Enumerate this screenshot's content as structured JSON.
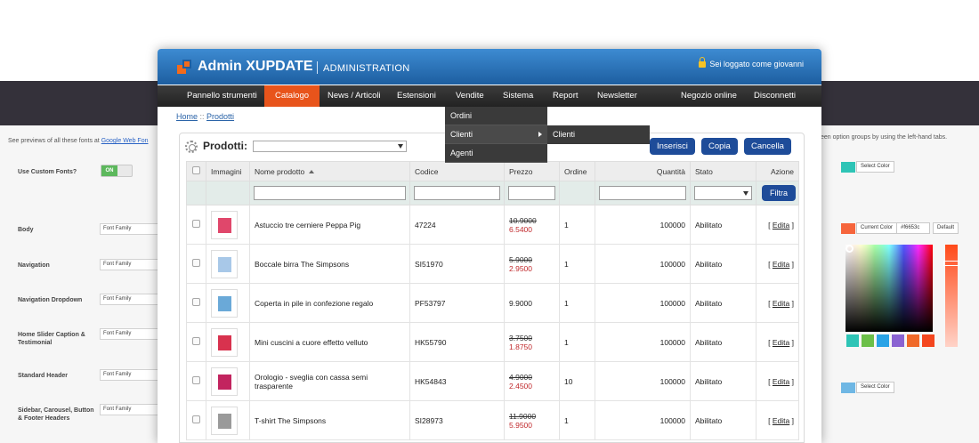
{
  "background_panel": {
    "intro_text": "See previews of all these fonts at",
    "intro_link": "Google Web Fon",
    "right_intro": "een option groups by using the left-hand tabs.",
    "use_custom_fonts_label": "Use Custom Fonts?",
    "toggle_on_label": "ON",
    "font_rows": [
      {
        "label": "Body",
        "select": "Font Family"
      },
      {
        "label": "Navigation",
        "select": "Font Family"
      },
      {
        "label": "Navigation Dropdown",
        "select": "Font Family"
      },
      {
        "label": "Home Slider Caption & Testimonial",
        "select": "Font Family"
      },
      {
        "label": "Standard Header",
        "select": "Font Family"
      },
      {
        "label": "Sidebar, Carousel, Button & Footer Headers",
        "select": "Font Family"
      }
    ],
    "select_color_label": "Select Color",
    "current_color_label": "Current Color",
    "current_color_value": "#f6653c",
    "default_label": "Default",
    "colors": {
      "teal": "#2ec4b6",
      "orange": "#f6653c",
      "light_blue": "#6fb7e4"
    },
    "swatches": [
      "#2ec4b6",
      "#4fc3c5",
      "#6cbf49",
      "#2aa3e6",
      "#8a63d2",
      "#f06a2a",
      "#f4471f"
    ]
  },
  "app": {
    "title": "Admin XUPDATE",
    "subtitle": "ADMINISTRATION",
    "login_text": "Sei loggato come giovanni"
  },
  "menu": {
    "items": [
      "Pannello strumenti",
      "Catalogo",
      "News / Articoli",
      "Estensioni",
      "Vendite",
      "Sistema",
      "Report",
      "Newsletter"
    ],
    "active": "Catalogo",
    "right_items": [
      "Negozio online",
      "Disconnetti"
    ],
    "dropdown": [
      "Ordini",
      "Clienti",
      "Agenti"
    ],
    "submenu": [
      "Clienti"
    ]
  },
  "breadcrumb": {
    "home": "Home",
    "sep": " :: ",
    "current": "Prodotti"
  },
  "panel": {
    "title": "Prodotti:",
    "buttons": {
      "insert": "Inserisci",
      "copy": "Copia",
      "delete": "Cancella"
    },
    "filter_button": "Filtra"
  },
  "table": {
    "headers": [
      "Immagini",
      "Nome prodotto",
      "Codice",
      "Prezzo",
      "Ordine",
      "Quantità",
      "Stato",
      "Azione"
    ],
    "rows": [
      {
        "name": "Astuccio tre cerniere Peppa Pig",
        "code": "47224",
        "price_old": "10.9000",
        "price_new": "6.5400",
        "order": "1",
        "qty": "100000",
        "status": "Abilitato",
        "action": "Edita",
        "thumb_color": "#e0476b"
      },
      {
        "name": "Boccale birra The Simpsons",
        "code": "SI51970",
        "price_old": "5.9000",
        "price_new": "2.9500",
        "order": "1",
        "qty": "100000",
        "status": "Abilitato",
        "action": "Edita",
        "thumb_color": "#a8c8e8"
      },
      {
        "name": "Coperta in pile in confezione regalo",
        "code": "PF53797",
        "price_old": "",
        "price_new": "9.9000",
        "order": "1",
        "qty": "100000",
        "status": "Abilitato",
        "action": "Edita",
        "thumb_color": "#6aa9d8"
      },
      {
        "name": "Mini cuscini a cuore effetto velluto",
        "code": "HK55790",
        "price_old": "3.7500",
        "price_new": "1.8750",
        "order": "1",
        "qty": "100000",
        "status": "Abilitato",
        "action": "Edita",
        "thumb_color": "#d8324e"
      },
      {
        "name": "Orologio - sveglia con cassa semi trasparente",
        "code": "HK54843",
        "price_old": "4.9000",
        "price_new": "2.4500",
        "order": "10",
        "qty": "100000",
        "status": "Abilitato",
        "action": "Edita",
        "thumb_color": "#c2245f"
      },
      {
        "name": "T-shirt The Simpsons",
        "code": "SI28973",
        "price_old": "11.9000",
        "price_new": "5.9500",
        "order": "1",
        "qty": "100000",
        "status": "Abilitato",
        "action": "Edita",
        "thumb_color": "#9a9a9a"
      }
    ]
  }
}
